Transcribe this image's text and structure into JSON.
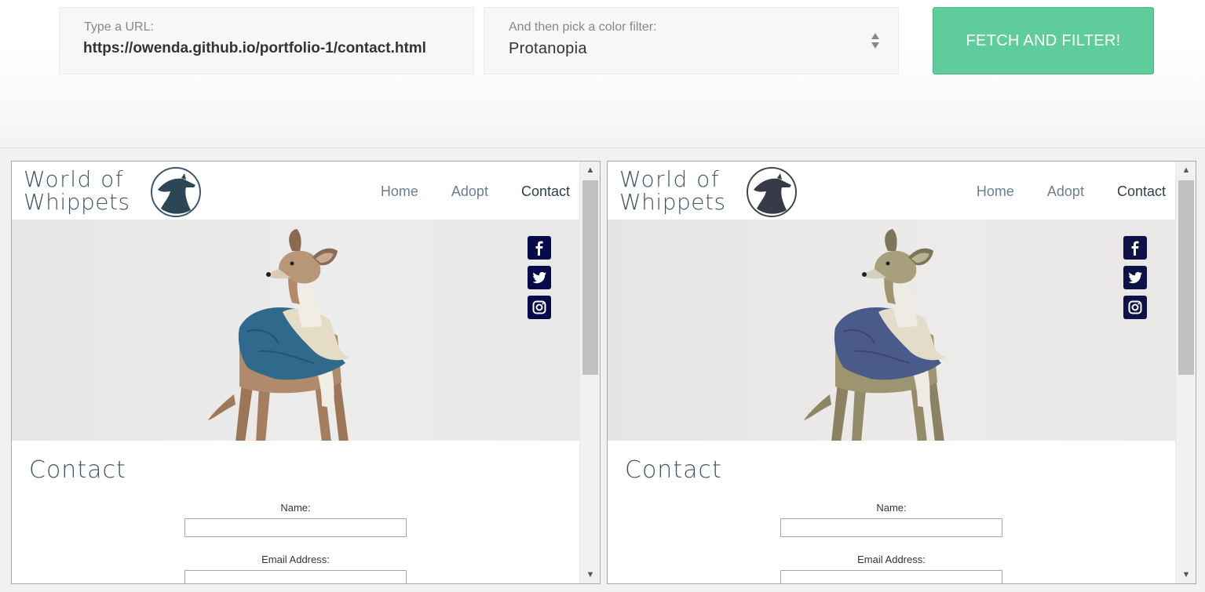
{
  "controls": {
    "url_label": "Type a URL:",
    "url_value": "https://owenda.github.io/portfolio-1/contact.html",
    "filter_label": "And then pick a color filter:",
    "filter_value": "Protanopia",
    "fetch_button": "FETCH AND FILTER!"
  },
  "site": {
    "logo_line1": "World of",
    "logo_line2": "Whippets",
    "nav": [
      "Home",
      "Adopt",
      "Contact"
    ],
    "active_nav": "Contact",
    "page_title": "Contact",
    "form": {
      "name_label": "Name:",
      "email_label": "Email Address:"
    },
    "social_icons": [
      "facebook-icon",
      "twitter-icon",
      "instagram-icon"
    ]
  },
  "colors": {
    "accent": "#5fcc9c",
    "original_coat": "#2f6a8c",
    "filtered_coat": "#4a5a8a",
    "social_icon_bg": "#060a4a",
    "logo_text": "#3d5566"
  }
}
